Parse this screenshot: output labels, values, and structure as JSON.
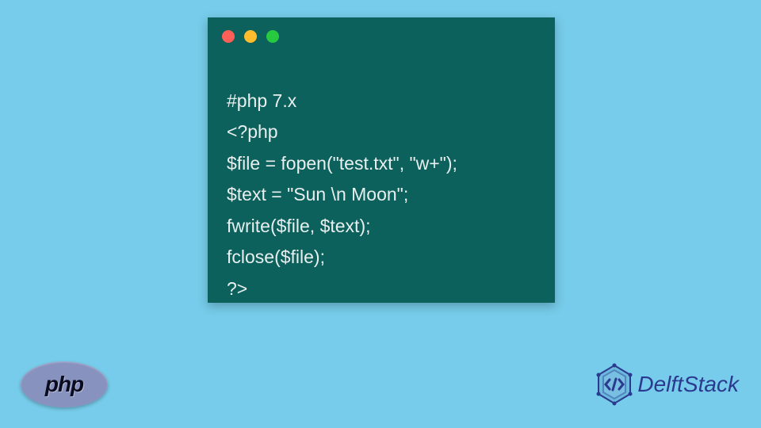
{
  "code": {
    "lines": [
      "#php 7.x",
      "<?php",
      "$file = fopen(\"test.txt\", \"w+\");",
      "$text = \"Sun \\n Moon\";",
      "fwrite($file, $text);",
      "fclose($file);",
      "?>"
    ]
  },
  "badges": {
    "php_label": "php",
    "delft_label": "DelftStack"
  },
  "colors": {
    "background": "#76ccea",
    "window_bg": "#0c615c",
    "code_text": "#e8efef",
    "php_purple": "#8892bf",
    "delft_blue": "#2b3a8f"
  }
}
